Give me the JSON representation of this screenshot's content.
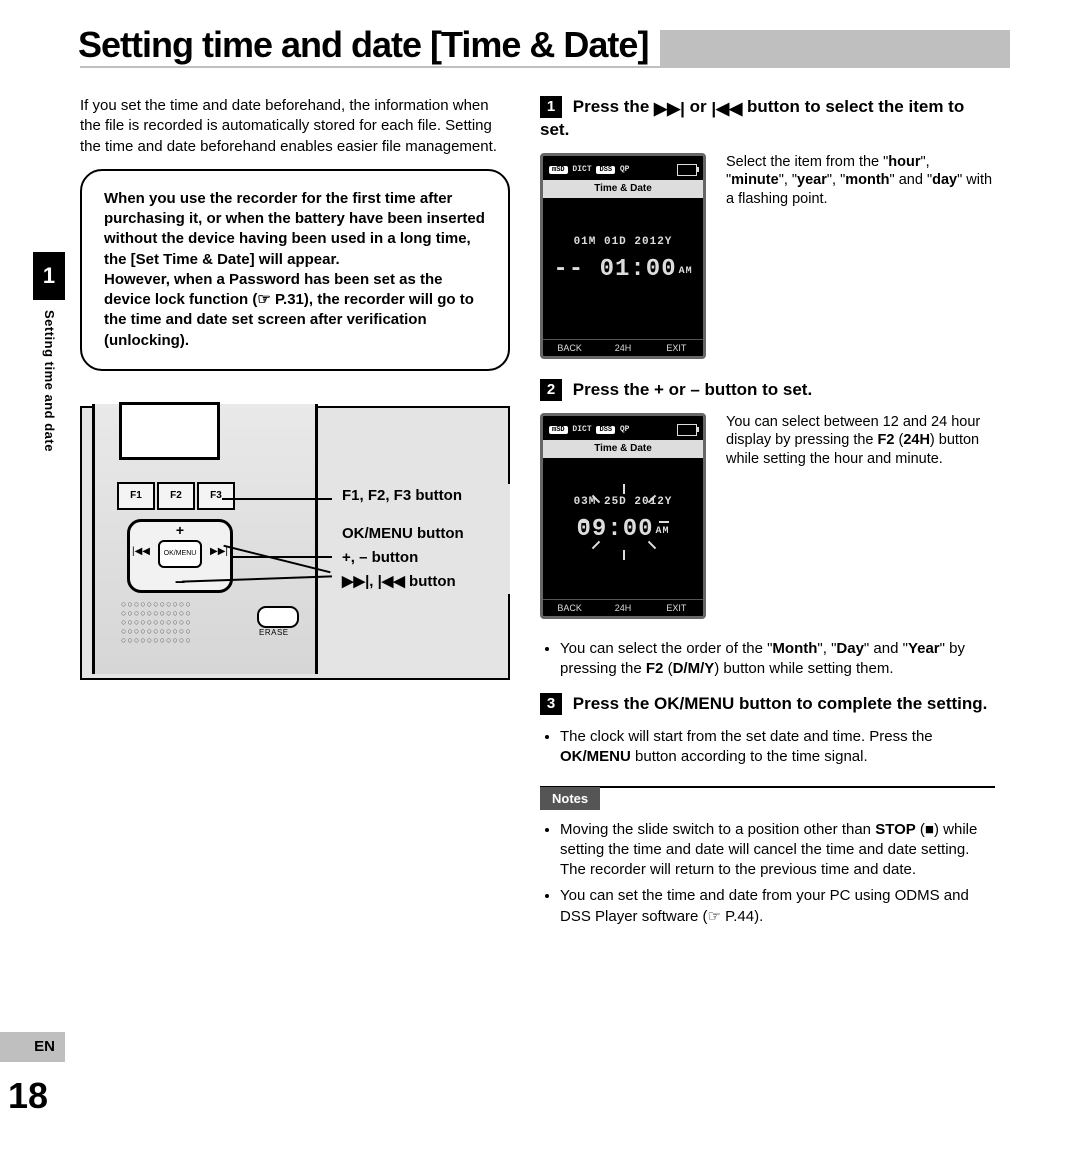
{
  "section_number": "1",
  "vertical_label": "Setting time and date",
  "lang_tab": "EN",
  "page_number": "18",
  "title": "Setting time and date [Time & Date]",
  "intro": "If you set the time and date beforehand, the information when the file is recorded is automatically stored for each file. Setting the time and date beforehand enables easier file management.",
  "box_p1_a": "When you use the recorder for the first time after purchasing it, or when the battery have been inserted without the device having been used in a long time, the [",
  "box_p1_menu": "Set Time & Date",
  "box_p1_b": "] will appear.",
  "box_p2_a": "However, when a Password has been set as the device lock function (☞ P.31), the recorder will go to the time and date set screen after verification (unlocking).",
  "diagram": {
    "f1": "F1",
    "f2": "F2",
    "f3": "F3",
    "ok_menu": "OK/MENU",
    "erase": "ERASE",
    "label1": "F1, F2, F3 button",
    "label2": "OK/MENU button",
    "label3": "+, – button",
    "label4_prefix": "",
    "label4": "▶▶|, |◀◀ button"
  },
  "step1": {
    "num": "1",
    "head_a": "Press the ",
    "head_b": " or ",
    "head_c": " button to select the item to set.",
    "side_a": "Select the item from the \"",
    "side_b": "\", \"",
    "side_c": "\", \"",
    "side_d": "\", \"",
    "side_e": "\" and \"",
    "side_f": "\" with a flashing point.",
    "w1": "hour",
    "w2": "minute",
    "w3": "year",
    "w4": "month",
    "w5": "day",
    "lcd": {
      "title": "Time & Date",
      "date": "01M 01D 2012Y",
      "time": "-- 01:00",
      "ampm": "AM",
      "soft1": "BACK",
      "soft2": "24H",
      "soft3": "EXIT",
      "top_sd": "mSD",
      "top_dict": "DICT",
      "top_dss": "DSS",
      "top_qp": "QP"
    }
  },
  "step2": {
    "num": "2",
    "head": "Press the + or – button to set.",
    "side_a": "You can select between 12 and 24 hour display by pressing the ",
    "side_b1": "F2",
    "side_b2": " (",
    "side_b3": "24H",
    "side_b4": ")",
    "side_c": " button while setting the hour and minute.",
    "lcd": {
      "title": "Time & Date",
      "date": "03M 25D 2012Y",
      "time": "09:00",
      "ampm": "AM",
      "soft1": "BACK",
      "soft2": "24H",
      "soft3": "EXIT"
    },
    "bullet_a": "You can select the order of the \"",
    "bullet_b1": "Month",
    "bullet_b2": "\", \"",
    "bullet_b3": "Day",
    "bullet_b4": "\" and \"",
    "bullet_b5": "Year",
    "bullet_c": "\" by pressing the ",
    "bullet_d1": "F2",
    "bullet_d2": " (",
    "bullet_d3": "D/M/Y",
    "bullet_d4": ")",
    "bullet_e": " button while setting them."
  },
  "step3": {
    "num": "3",
    "head": "Press the OK/MENU button to complete the setting.",
    "bullet_a": "The clock will start from the set date and time. Press the ",
    "bullet_b": "OK/MENU",
    "bullet_c": " button according to the time signal."
  },
  "notes": {
    "label": "Notes",
    "n1_a": "Moving the slide switch to a position other than ",
    "n1_b": "STOP",
    "n1_c": " (■) while setting the time and date will cancel the time and date setting. The recorder will return to the previous time and date.",
    "n2": "You can set the time and date from your PC using ODMS and DSS Player software (☞ P.44)."
  }
}
